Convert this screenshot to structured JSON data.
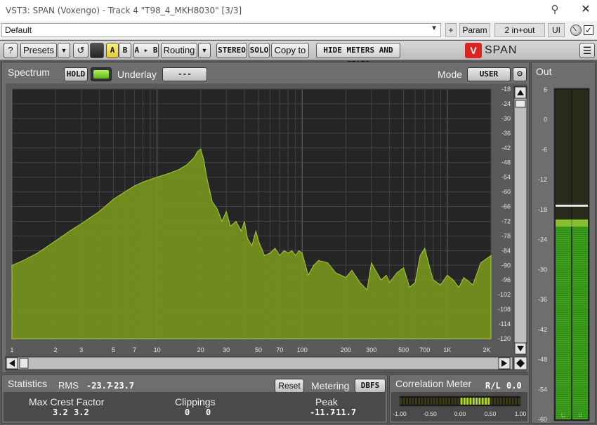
{
  "window": {
    "title": "VST3: SPAN (Voxengo) - Track 4 \"T98_4_MKH8030\" [3/3]"
  },
  "presetbar": {
    "preset_value": "Default",
    "plus_label": "+",
    "param_label": "Param",
    "routing_label": "2 in+out",
    "ui_label": "UI"
  },
  "toolbar": {
    "help_label": "?",
    "presets_label": "Presets",
    "a_label": "A",
    "b_label": "B",
    "ab_label": "A ▸ B",
    "routing_label": "Routing",
    "stereo_label": "STEREO",
    "solo_label": "SOLO",
    "copyto_label": "Copy to",
    "hide_label": "HIDE METERS AND STATS",
    "logo_name": "SPAN"
  },
  "spectrum": {
    "title": "Spectrum",
    "hold_label": "HOLD",
    "underlay_label": "Underlay",
    "underlay_value": "---",
    "mode_label": "Mode",
    "mode_value": "USER",
    "db_ticks": [
      "-18",
      "-24",
      "-30",
      "-36",
      "-42",
      "-48",
      "-54",
      "-60",
      "-66",
      "-72",
      "-78",
      "-84",
      "-90",
      "-96",
      "-102",
      "-108",
      "-114",
      "-120"
    ],
    "freq_ticks": [
      "1",
      "2",
      "3",
      "5",
      "7",
      "10",
      "20",
      "30",
      "50",
      "70",
      "100",
      "200",
      "300",
      "500",
      "700",
      "1K",
      "2K"
    ]
  },
  "chart_data": {
    "type": "area",
    "xlabel": "",
    "ylabel": "",
    "x_scale": "log",
    "xlim": [
      1,
      2000
    ],
    "ylim": [
      -120,
      -18
    ],
    "grid": true,
    "color": "#7a9a1e",
    "series": [
      {
        "x": [
          1,
          1.2,
          1.5,
          2,
          2.5,
          3,
          4,
          5,
          6,
          7,
          8,
          10,
          12,
          14,
          16,
          18,
          19,
          20,
          21,
          22,
          24,
          26,
          28,
          30,
          32,
          35,
          38,
          40,
          42,
          45,
          48,
          50,
          55,
          60,
          65,
          70,
          75,
          80,
          85,
          90,
          95,
          100,
          110,
          120,
          130,
          150,
          170,
          200,
          220,
          250,
          280,
          300,
          320,
          350,
          380,
          400,
          450,
          500,
          550,
          600,
          650,
          700,
          750,
          800,
          900,
          1000,
          1100,
          1200,
          1300,
          1500,
          1700,
          2000
        ],
        "y": [
          -90,
          -88,
          -85,
          -80,
          -76,
          -73,
          -68,
          -63,
          -60,
          -57.5,
          -56,
          -54,
          -52.5,
          -51,
          -49,
          -46,
          -43.5,
          -42.5,
          -47,
          -54,
          -64,
          -67,
          -72,
          -68,
          -74,
          -72,
          -76,
          -72,
          -79,
          -82,
          -76,
          -80,
          -86,
          -85,
          -83,
          -86,
          -84,
          -85,
          -84,
          -86,
          -84,
          -85,
          -94,
          -90,
          -88,
          -89,
          -93,
          -95,
          -92,
          -97,
          -100,
          -89,
          -92,
          -96,
          -94,
          -97,
          -93,
          -91,
          -99,
          -97,
          -86,
          -83,
          -90,
          -96,
          -98,
          -94,
          -96,
          -99,
          -95,
          -98,
          -89,
          -86
        ]
      }
    ]
  },
  "out_meter": {
    "title": "Out",
    "ticks": [
      "6",
      "0",
      "-6",
      "-12",
      "-18",
      "-24",
      "-30",
      "-36",
      "-42",
      "-48",
      "-54",
      "-60"
    ],
    "left_level_db": -20,
    "right_level_db": -20,
    "hold_db": -17,
    "left_label": "C",
    "right_label": "0"
  },
  "statistics": {
    "title": "Statistics",
    "rms_label": "RMS",
    "rms_left": "-23.7",
    "rms_right": "-23.7",
    "reset_label": "Reset",
    "metering_label": "Metering",
    "metering_value": "DBFS",
    "crest_label": "Max Crest Factor",
    "crest_left": "3.2",
    "crest_right": "3.2",
    "clip_label": "Clippings",
    "clip_left": "0",
    "clip_right": "0",
    "peak_label": "Peak",
    "peak_left": "-11.7",
    "peak_right": "-11.7"
  },
  "correlation": {
    "title": "Correlation Meter",
    "rl_label": "R/L",
    "rl_value": "0.0",
    "value": 0.0,
    "ticks": [
      "-1.00",
      "-0.50",
      "0.00",
      "0.50",
      "1.00"
    ]
  }
}
